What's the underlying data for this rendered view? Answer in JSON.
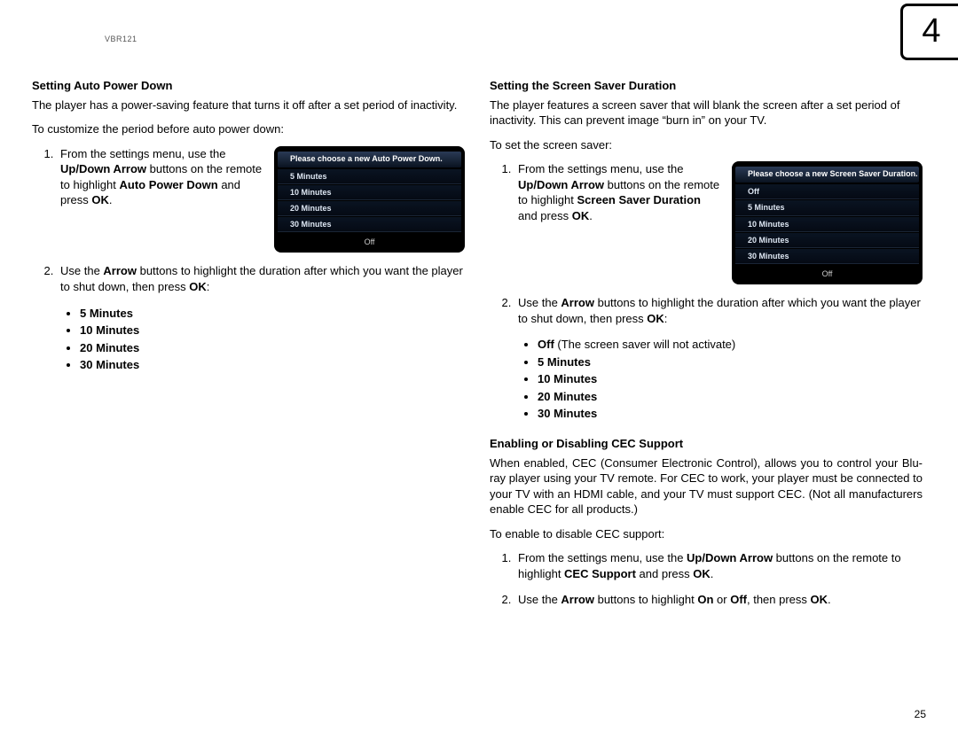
{
  "header": {
    "model": "VBR121",
    "chapter": "4"
  },
  "left": {
    "heading1": "Setting Auto Power Down",
    "intro1": "The player has a power-saving feature that turns it off after a set period of inactivity.",
    "intro2": "To customize the period before auto power down:",
    "step1_a": "From the settings menu, use the ",
    "step1_b": "Up/Down Arrow",
    "step1_c": " buttons on the remote to highlight ",
    "step1_d": "Auto Power Down",
    "step1_e": " and press ",
    "step1_f": "OK",
    "step1_g": ".",
    "step2_a": "Use the ",
    "step2_b": "Arrow",
    "step2_c": " buttons to highlight the duration after which you want the player to shut down, then press ",
    "step2_d": "OK",
    "step2_e": ":",
    "options": [
      "5 Minutes",
      "10 Minutes",
      "20 Minutes",
      "30 Minutes"
    ],
    "ss_title": "Please choose a new Auto Power Down.",
    "ss_options": [
      "5 Minutes",
      "10 Minutes",
      "20 Minutes",
      "30 Minutes"
    ],
    "ss_footer": "Off"
  },
  "right": {
    "heading1": "Setting the Screen Saver Duration",
    "intro1": "The player features a screen saver that will blank the screen after a set period of inactivity. This can prevent image “burn in” on your TV.",
    "intro2": "To set the screen saver:",
    "step1_a": "From the settings menu, use the ",
    "step1_b": "Up/Down Arrow",
    "step1_c": " buttons on the remote to highlight ",
    "step1_d": "Screen Saver Duration",
    "step1_e": " and press ",
    "step1_f": "OK",
    "step1_g": ".",
    "step2_a": "Use the ",
    "step2_b": "Arrow",
    "step2_c": " buttons to highlight the duration after which you want the player to shut down, then press ",
    "step2_d": "OK",
    "step2_e": ":",
    "opt_off_a": "Off",
    "opt_off_b": " (The screen saver will not activate)",
    "options": [
      "5 Minutes",
      "10 Minutes",
      "20 Minutes",
      "30 Minutes"
    ],
    "ss_title": "Please choose a new Screen Saver Duration.",
    "ss_options": [
      "Off",
      "5 Minutes",
      "10 Minutes",
      "20 Minutes",
      "30 Minutes"
    ],
    "ss_footer": "Off",
    "heading2": "Enabling or Disabling CEC Support",
    "cec_p1": "When enabled, CEC (Consumer Electronic Control), allows you to control your Blu-ray player using your TV remote. For CEC to work, your player must be connected to your TV with an HDMI cable, and your TV must support CEC. (Not all manufacturers enable CEC for all products.)",
    "cec_p2": "To enable to disable CEC support:",
    "cec_s1_a": "From the settings menu, use the ",
    "cec_s1_b": "Up/Down Arrow",
    "cec_s1_c": " buttons on the remote to highlight ",
    "cec_s1_d": "CEC Support",
    "cec_s1_e": " and press ",
    "cec_s1_f": "OK",
    "cec_s1_g": ".",
    "cec_s2_a": "Use the ",
    "cec_s2_b": "Arrow",
    "cec_s2_c": " buttons to highlight ",
    "cec_s2_d": "On",
    "cec_s2_e": " or ",
    "cec_s2_f": "Off",
    "cec_s2_g": ", then press ",
    "cec_s2_h": "OK",
    "cec_s2_i": "."
  },
  "page_num": "25"
}
